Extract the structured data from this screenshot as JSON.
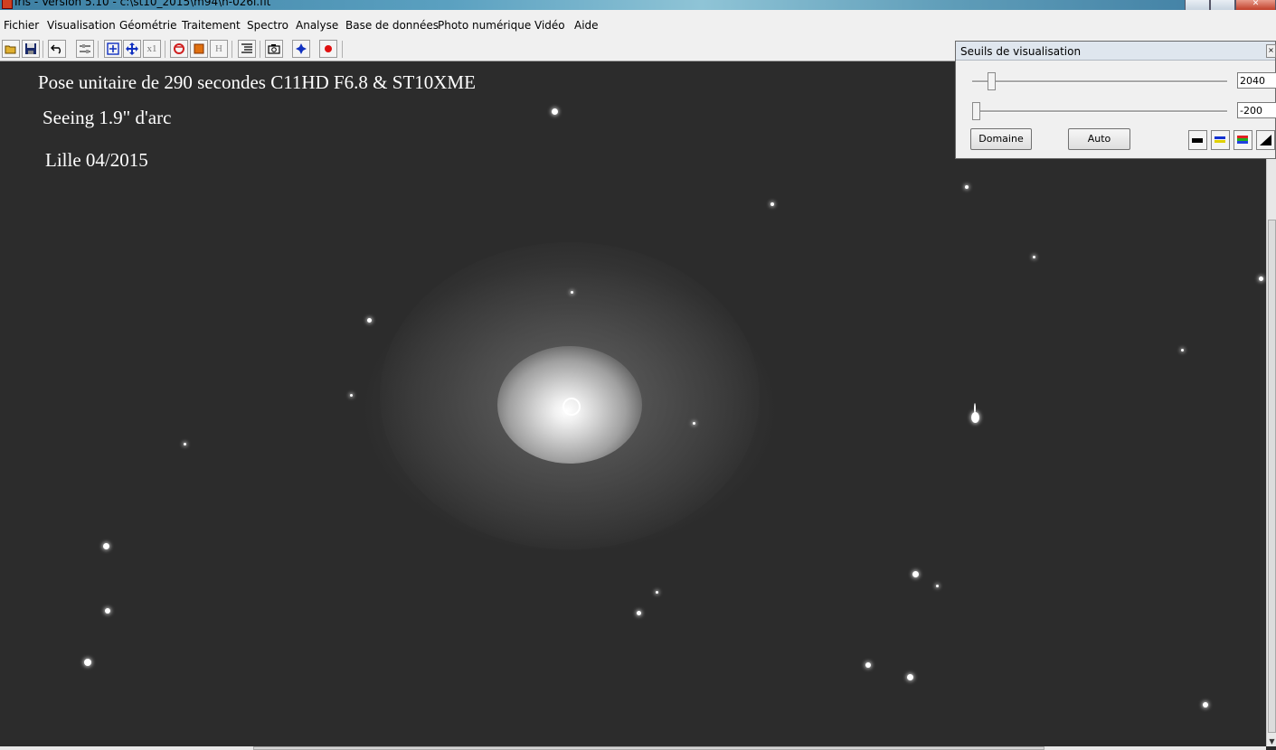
{
  "window": {
    "title": "Iris - Version 5.10 - c:\\st10_2015\\m94\\n-026l.fit"
  },
  "menu": [
    "Fichier",
    "Visualisation",
    "Géométrie",
    "Traitement",
    "Spectro",
    "Analyse",
    "Base de données",
    "Photo numérique",
    "Vidéo",
    "Aide"
  ],
  "toolbar": {
    "buttons": [
      "open-icon",
      "save-icon",
      "undo-icon",
      "threshold-icon",
      "zoom-in-icon",
      "move-icon",
      "zoom-x1-icon",
      "refresh-icon",
      "color-icon",
      "histogram-icon",
      "list-icon",
      "camera-icon",
      "center-icon",
      "record-icon"
    ],
    "zoom_label": "x1",
    "h_label": "H"
  },
  "image": {
    "annotations": {
      "line1": "Pose unitaire de 290 secondes   C11HD  F6.8  & ST10XME",
      "line2": "Seeing 1.9\" d'arc",
      "line3": "Lille 04/2015"
    }
  },
  "thresholds_dialog": {
    "title": "Seuils de visualisation",
    "high_value": "2040",
    "low_value": "-200",
    "high_level": 0.08,
    "low_level": 0.0,
    "domain_button": "Domaine",
    "auto_button": "Auto",
    "palettes": [
      "palette-black-icon",
      "palette-blue-yellow-icon",
      "palette-rainbow-icon",
      "palette-gradient-icon"
    ]
  }
}
